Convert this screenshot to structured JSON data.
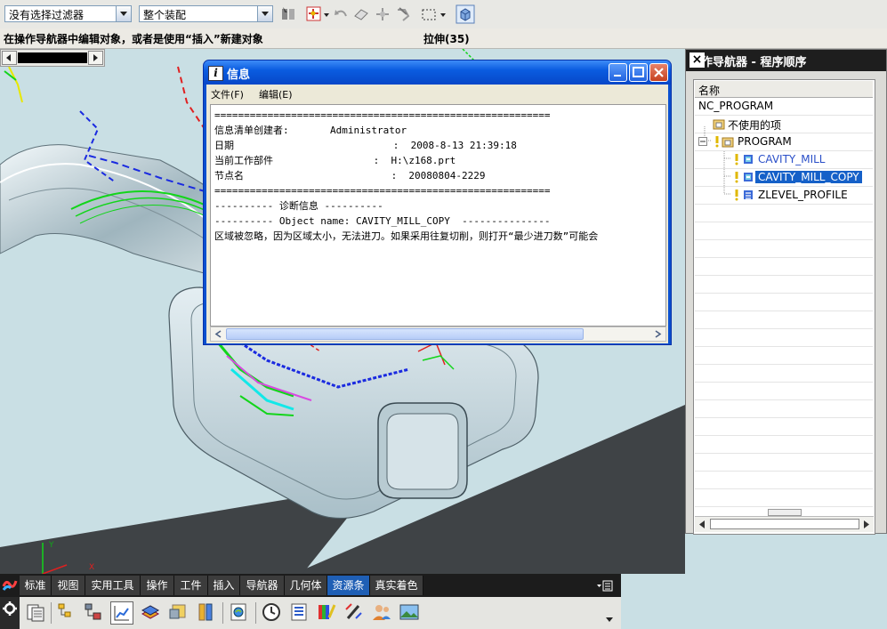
{
  "toolbar": {
    "filter_combo": "没有选择过滤器",
    "scope_combo": "整个装配"
  },
  "status_bar": {
    "prompt": "在操作导航器中编辑对象，或者是使用“插入”新建对象",
    "status": "拉伸(35)"
  },
  "info_window": {
    "title": "信息",
    "title_icon": "i",
    "menu": [
      "文件(F)",
      "编辑(E)"
    ],
    "lines": [
      "=========================================================",
      "信息清单创建者:       Administrator",
      "日期                           :  2008-8-13 21:39:18",
      "当前工作部件                 :  H:\\z168.prt",
      "节点名                         :  20080804-2229",
      "=========================================================",
      "---------- 诊断信息 ----------",
      "---------- Object name: CAVITY_MILL_COPY  ---------------",
      "区域被忽略，因为区域太小，无法进刀。如果采用往复切削，则打开“最少进刀数”可能会"
    ]
  },
  "navigator": {
    "title": "操作导航器 - 程序顺序",
    "column_header": "名称",
    "rows": [
      {
        "label": "NC_PROGRAM",
        "indent": 0
      },
      {
        "label": "不使用的项",
        "indent": 1
      },
      {
        "label": "PROGRAM",
        "indent": 1
      },
      {
        "label": "CAVITY_MILL",
        "indent": 2
      },
      {
        "label": "CAVITY_MILL_COPY",
        "indent": 2,
        "selected": true
      },
      {
        "label": "ZLEVEL_PROFILE",
        "indent": 2
      }
    ]
  },
  "dock": {
    "tabs": [
      "标准",
      "视图",
      "实用工具",
      "操作",
      "工件",
      "插入",
      "导航器",
      "几何体",
      "资源条",
      "真实着色"
    ],
    "active_tab": "资源条",
    "icons": [
      "settings-icon",
      "document-list-icon",
      "operation-navigator-icon",
      "tree-icon",
      "toolpath-icon",
      "layers-icon",
      "part-icon",
      "bookmark-icon",
      "globe-icon",
      "clock-icon",
      "list-icon",
      "palette-icon",
      "pen-icon",
      "users-icon",
      "image-icon"
    ]
  },
  "colors": {
    "titlebar_blue": "#0a5ce0",
    "selection_blue": "#1560c8",
    "viewport_bg": "#c9dfe4",
    "dock_bg": "#1c1c1c"
  }
}
